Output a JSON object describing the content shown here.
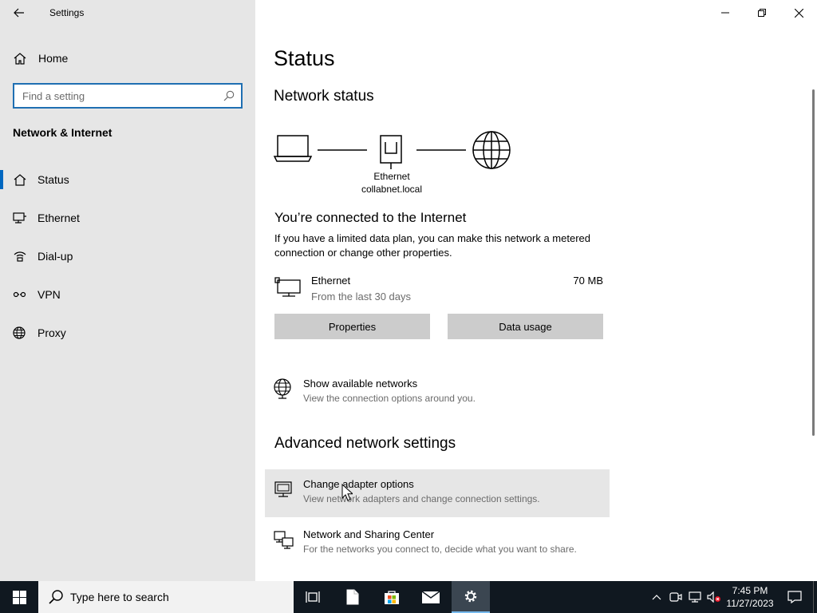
{
  "window": {
    "title": "Settings"
  },
  "sidebar": {
    "home_label": "Home",
    "search_placeholder": "Find a setting",
    "section_title": "Network & Internet",
    "items": [
      {
        "label": "Status",
        "icon": "home-status-icon",
        "active": true
      },
      {
        "label": "Ethernet",
        "icon": "ethernet-icon",
        "active": false
      },
      {
        "label": "Dial-up",
        "icon": "dial-up-icon",
        "active": false
      },
      {
        "label": "VPN",
        "icon": "vpn-icon",
        "active": false
      },
      {
        "label": "Proxy",
        "icon": "globe-icon",
        "active": false
      }
    ]
  },
  "main": {
    "page_title": "Status",
    "network_status_heading": "Network status",
    "diagram": {
      "adapter_name": "Ethernet",
      "domain": "collabnet.local"
    },
    "connected_title": "You’re connected to the Internet",
    "connected_desc": "If you have a limited data plan, you can make this network a metered connection or change other properties.",
    "ethernet": {
      "name": "Ethernet",
      "period": "From the last 30 days",
      "usage": "70 MB"
    },
    "buttons": {
      "properties": "Properties",
      "data_usage": "Data usage"
    },
    "show_networks": {
      "title": "Show available networks",
      "desc": "View the connection options around you."
    },
    "advanced_heading": "Advanced network settings",
    "change_adapter": {
      "title": "Change adapter options",
      "desc": "View network adapters and change connection settings."
    },
    "sharing_center": {
      "title": "Network and Sharing Center",
      "desc": "For the networks you connect to, decide what you want to share."
    }
  },
  "taskbar": {
    "search_placeholder": "Type here to search",
    "time": "7:45 PM",
    "date": "11/27/2023"
  },
  "colors": {
    "sidebar_bg": "#e6e6e6",
    "accent": "#0067c0",
    "button_bg": "#cccccc",
    "taskbar_bg": "#101820"
  }
}
